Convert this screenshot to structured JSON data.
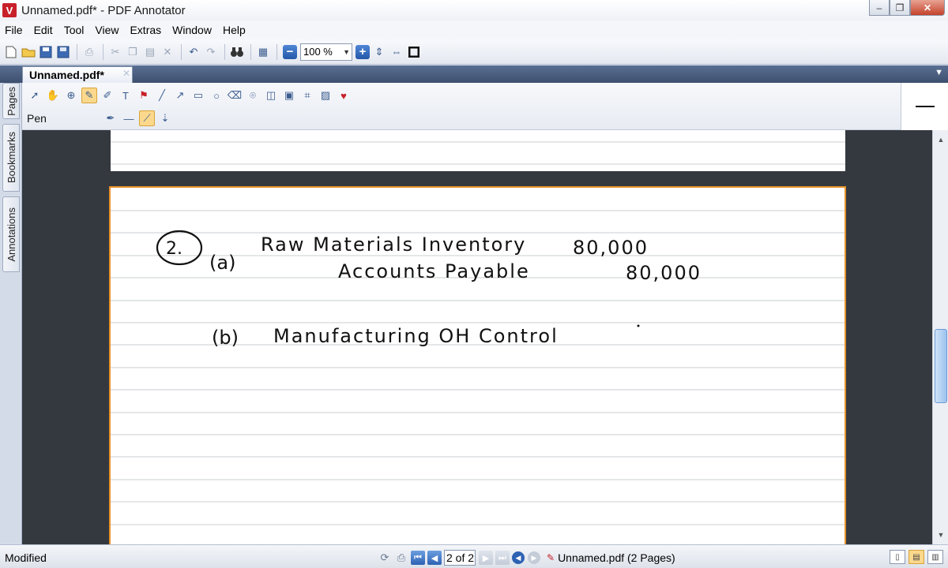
{
  "window": {
    "title": "Unnamed.pdf* - PDF Annotator",
    "app_icon_glyph": "V",
    "controls": [
      "–",
      "❐",
      "✕"
    ]
  },
  "menu": [
    "File",
    "Edit",
    "Tool",
    "View",
    "Extras",
    "Window",
    "Help"
  ],
  "toolbar": {
    "zoom_value": "100 %",
    "zoom_out_glyph": "−",
    "zoom_in_glyph": "+"
  },
  "tab": {
    "label": "Unnamed.pdf*",
    "close_glyph": "✕"
  },
  "side_tabs": [
    "Pages",
    "Bookmarks",
    "Annotations"
  ],
  "annotation_toolbar": {
    "current_tool": "Pen"
  },
  "document": {
    "ink_color": "#111111",
    "page_border_color": "#e8922b",
    "handwriting": {
      "item_number": "2.",
      "line_a_label": "(a)",
      "line_a_text": "Raw Materials Inventory",
      "line_a_debit": "80,000",
      "line_a_credit_text": "Accounts Payable",
      "line_a_credit": "80,000",
      "line_b_label": "(b)",
      "line_b_text": "Manufacturing OH Control"
    }
  },
  "status": {
    "state": "Modified",
    "page_indicator": "2 of 2",
    "file_info": "Unnamed.pdf (2 Pages)"
  },
  "colors": {
    "accent": "#2d62b4",
    "active_tool": "#fbd88c",
    "close_button": "#c4412a"
  }
}
